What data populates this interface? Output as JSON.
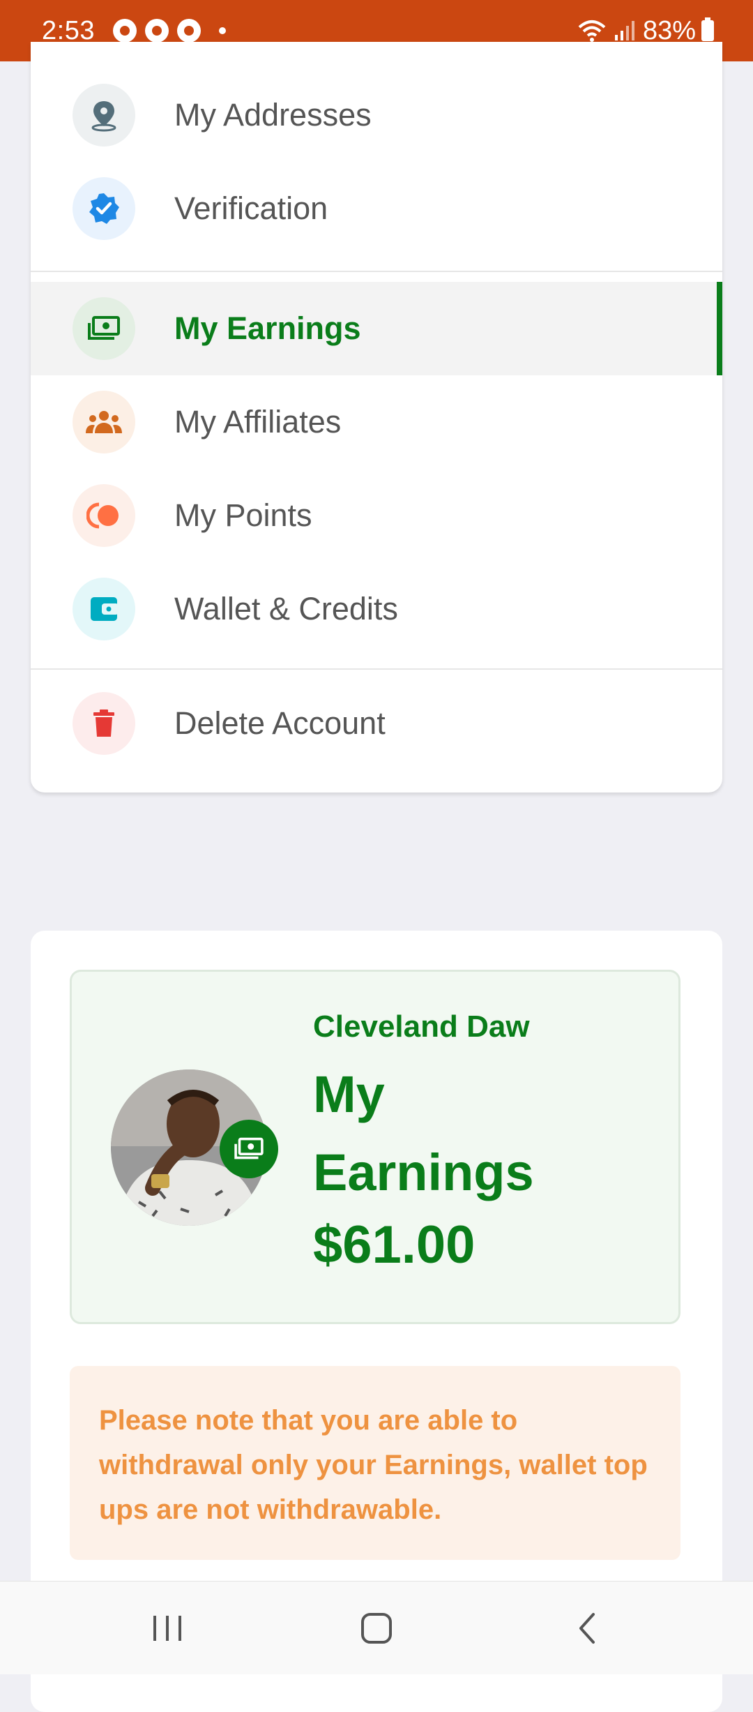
{
  "status_bar": {
    "time": "2:53",
    "battery": "83%",
    "icons": [
      "chrome-icon",
      "chrome-icon",
      "chrome-icon",
      "notification-dot",
      "wifi-icon",
      "signal-icon",
      "battery-icon"
    ]
  },
  "menu": {
    "items": [
      {
        "label": "My Addresses",
        "icon": "location-pin-icon",
        "icon_bg": "#edf0f1",
        "icon_color": "#546e7a"
      },
      {
        "label": "Verification",
        "icon": "verified-badge-icon",
        "icon_bg": "#e8f2fd",
        "icon_color": "#1e88e5"
      },
      {
        "label": "My Earnings",
        "icon": "money-icon",
        "icon_bg": "#e3efe3",
        "icon_color": "#0a7d1a",
        "active": true
      },
      {
        "label": "My Affiliates",
        "icon": "group-icon",
        "icon_bg": "#fcefe5",
        "icon_color": "#d2691e"
      },
      {
        "label": "My Points",
        "icon": "points-icon",
        "icon_bg": "#fdefe9",
        "icon_color": "#ff7043"
      },
      {
        "label": "Wallet & Credits",
        "icon": "wallet-icon",
        "icon_bg": "#e3f7f9",
        "icon_color": "#00acc1"
      },
      {
        "label": "Delete Account",
        "icon": "trash-icon",
        "icon_bg": "#fdecec",
        "icon_color": "#e53935"
      }
    ]
  },
  "earnings": {
    "user_name": "Cleveland Daw",
    "title": "My Earnings",
    "amount": "$61.00",
    "accent_color": "#0a7d1a",
    "badge_icon": "money-icon"
  },
  "notice": {
    "text": "Please note that you are able to withdrawal only your Earnings, wallet top ups are not withdrawable.",
    "color": "#ee9240"
  },
  "nav": {
    "buttons": [
      "recent-apps-icon",
      "home-icon",
      "back-icon"
    ]
  }
}
